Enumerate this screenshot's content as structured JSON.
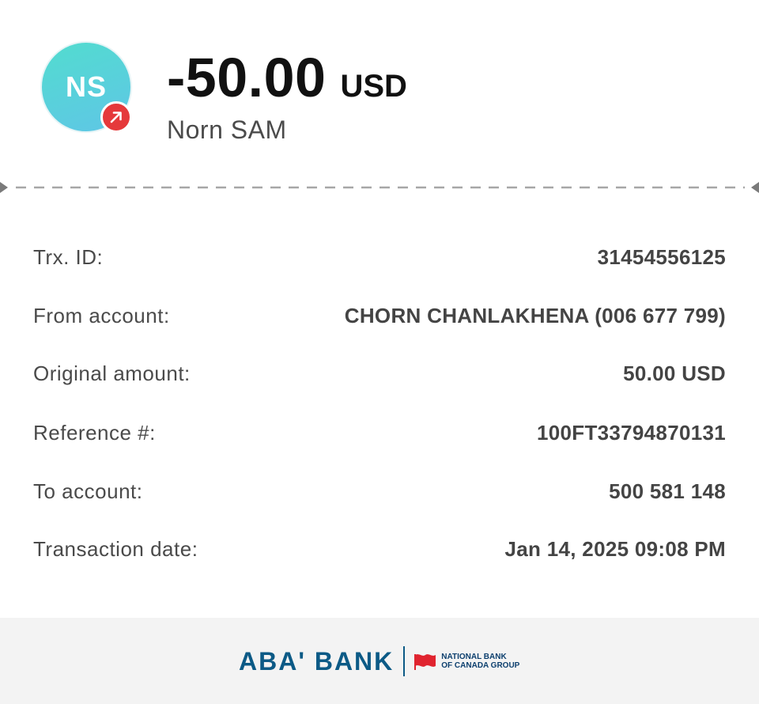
{
  "header": {
    "avatar_initials": "NS",
    "badge_icon": "outgoing-arrow-icon",
    "amount": "-50.00",
    "currency": "USD",
    "payee": "Norn SAM"
  },
  "details": [
    {
      "label": "Trx. ID:",
      "value": "31454556125"
    },
    {
      "label": "From account:",
      "value": "CHORN CHANLAKHENA (006 677 799)"
    },
    {
      "label": "Original amount:",
      "value": "50.00 USD"
    },
    {
      "label": "Reference #:",
      "value": "100FT33794870131"
    },
    {
      "label": "To account:",
      "value": "500 581 148"
    },
    {
      "label": "Transaction date:",
      "value": "Jan 14, 2025 09:08 PM"
    }
  ],
  "footer": {
    "brand": "ABA' BANK",
    "partner_line1": "NATIONAL BANK",
    "partner_line2": "OF CANADA GROUP"
  },
  "colors": {
    "avatar_gradient_start": "#52dccf",
    "avatar_gradient_end": "#5fc6e6",
    "badge": "#e5393b",
    "brand_blue": "#0c5a86",
    "partner_red": "#e0242f"
  }
}
